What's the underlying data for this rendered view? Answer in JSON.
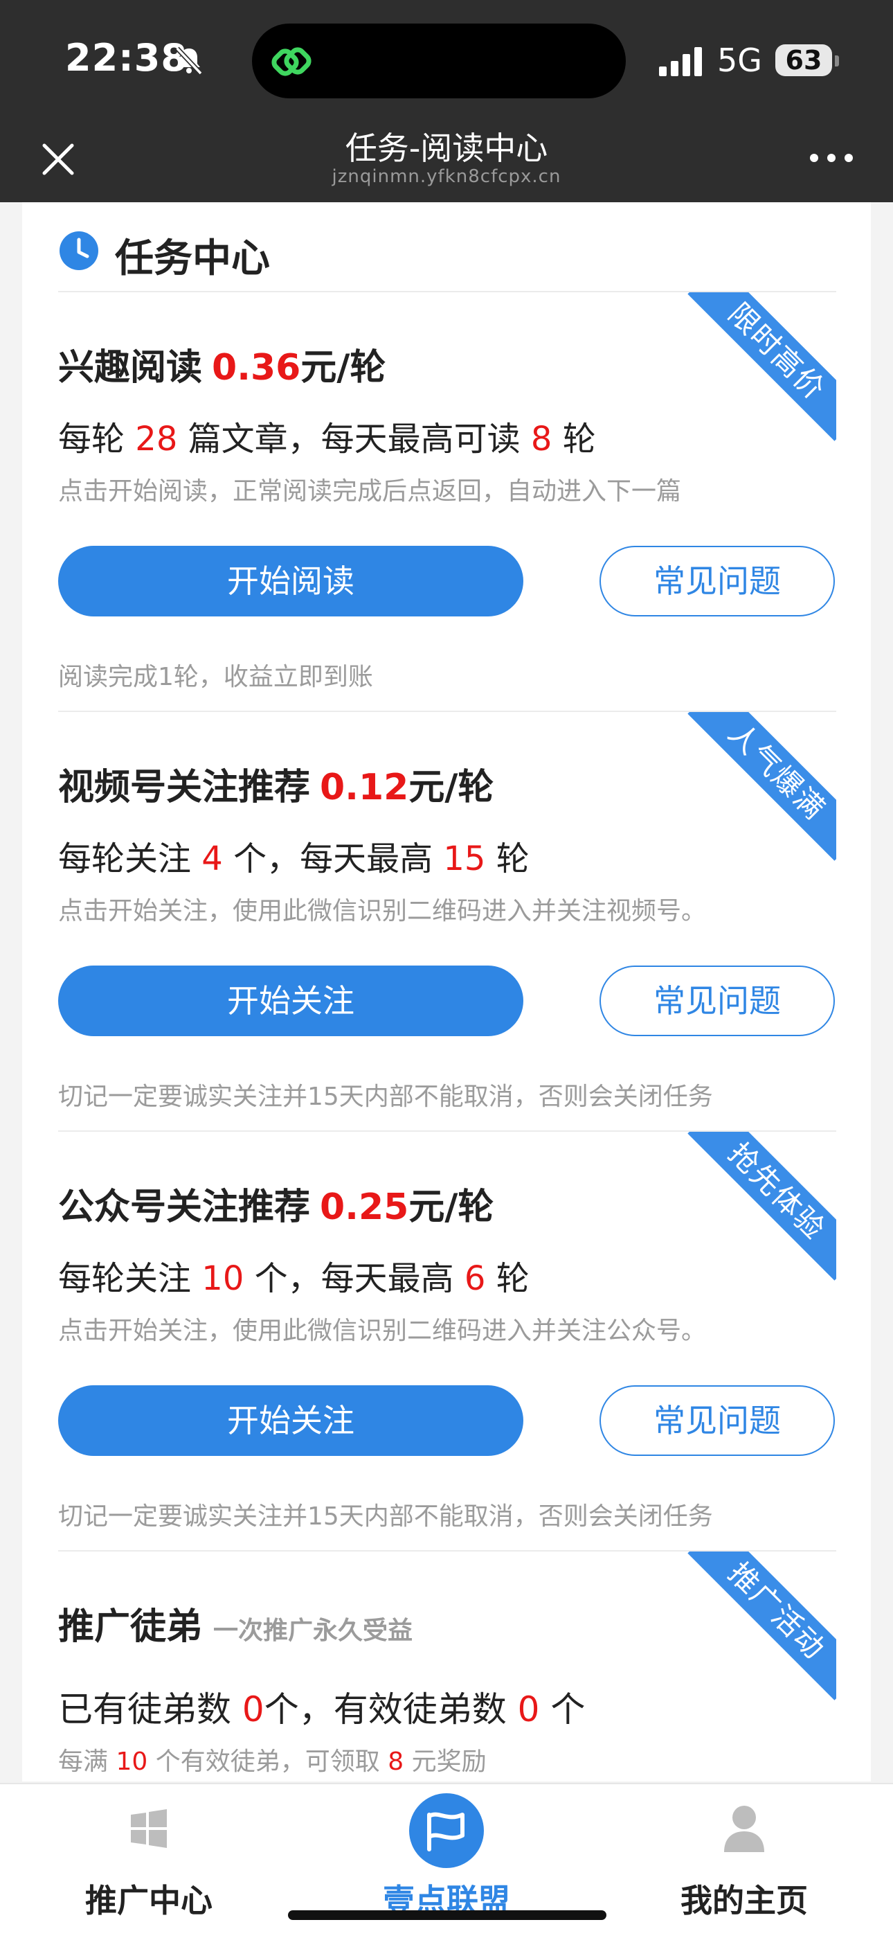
{
  "status_bar": {
    "time": "22:38",
    "network": "5G",
    "battery": "63"
  },
  "nav": {
    "title": "任务-阅读中心",
    "domain": "jznqinmn.yfkn8cfcpx.cn"
  },
  "section": {
    "title": "任务中心"
  },
  "tasks": [
    {
      "ribbon": "限时高价",
      "title": "兴趣阅读",
      "price": "0.36",
      "price_unit": "元/轮",
      "desc_prefix": "每轮",
      "desc_num1": "28",
      "desc_mid": "篇文章，每天最高可读",
      "desc_num2": "8",
      "desc_suffix": "轮",
      "hint": "点击开始阅读，正常阅读完成后点返回，自动进入下一篇",
      "primary_label": "开始阅读",
      "faq_label": "常见问题",
      "note": "阅读完成1轮，收益立即到账"
    },
    {
      "ribbon": "人气爆满",
      "title": "视频号关注推荐",
      "price": "0.12",
      "price_unit": "元/轮",
      "desc_prefix": "每轮关注",
      "desc_num1": "4",
      "desc_mid": "个，每天最高",
      "desc_num2": "15",
      "desc_suffix": "轮",
      "hint": "点击开始关注，使用此微信识别二维码进入并关注视频号。",
      "primary_label": "开始关注",
      "faq_label": "常见问题",
      "note": "切记一定要诚实关注并15天内部不能取消，否则会关闭任务"
    },
    {
      "ribbon": "抢先体验",
      "title": "公众号关注推荐",
      "price": "0.25",
      "price_unit": "元/轮",
      "desc_prefix": "每轮关注",
      "desc_num1": "10",
      "desc_mid": "个，每天最高",
      "desc_num2": "6",
      "desc_suffix": "轮",
      "hint": "点击开始关注，使用此微信识别二维码进入并关注公众号。",
      "primary_label": "开始关注",
      "faq_label": "常见问题",
      "note": "切记一定要诚实关注并15天内部不能取消，否则会关闭任务"
    }
  ],
  "promo": {
    "ribbon": "推广活动",
    "title": "推广徒弟",
    "subtitle": "一次推广永久受益",
    "desc_prefix": "已有徒弟数",
    "desc_num1": "0",
    "desc_mid": "个，有效徒弟数",
    "desc_num2": "0",
    "desc_suffix": "个",
    "hint_prefix": "每满",
    "hint_num1": "10",
    "hint_mid": "个有效徒弟，可领取",
    "hint_num2": "8",
    "hint_suffix": "元奖励"
  },
  "tab_bar": {
    "items": [
      {
        "label": "推广中心",
        "icon": "windows-grid-icon"
      },
      {
        "label": "壹点联盟",
        "icon": "flag-icon"
      },
      {
        "label": "我的主页",
        "icon": "person-icon"
      }
    ]
  },
  "colors": {
    "accent": "#2f86e4",
    "highlight": "#e81818",
    "ribbon": "#3a8de8",
    "header_bg": "#2e2e2e"
  }
}
